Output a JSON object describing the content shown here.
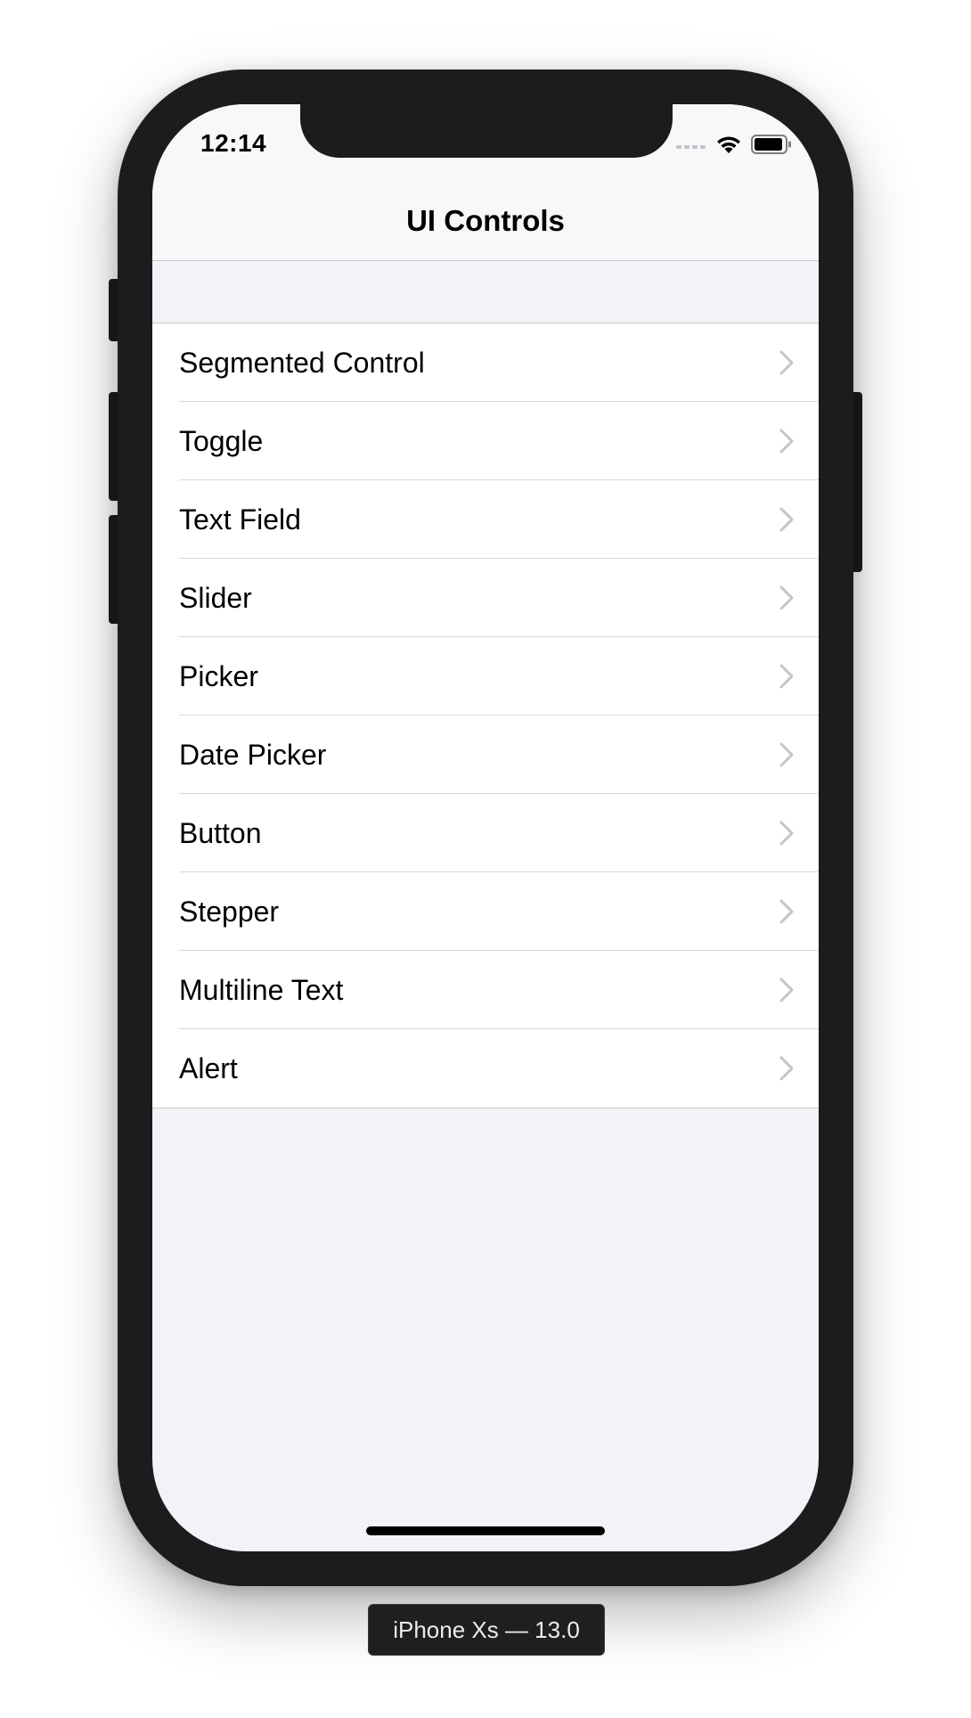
{
  "status_bar": {
    "time": "12:14",
    "icons": [
      "cellular-signal-icon",
      "wifi-icon",
      "battery-icon"
    ]
  },
  "nav": {
    "title": "UI Controls"
  },
  "list": {
    "items": [
      {
        "label": "Segmented Control"
      },
      {
        "label": "Toggle"
      },
      {
        "label": "Text Field"
      },
      {
        "label": "Slider"
      },
      {
        "label": "Picker"
      },
      {
        "label": "Date Picker"
      },
      {
        "label": "Button"
      },
      {
        "label": "Stepper"
      },
      {
        "label": "Multiline Text"
      },
      {
        "label": "Alert"
      }
    ]
  },
  "device": {
    "label": "iPhone Xs — 13.0"
  },
  "colors": {
    "screen_background": "#f2f2f7",
    "nav_background": "#f8f8fa",
    "cell_background": "#ffffff",
    "separator": "#d8d8dc",
    "chevron": "#c4c4c9",
    "phone_body": "#1c1c1e"
  }
}
